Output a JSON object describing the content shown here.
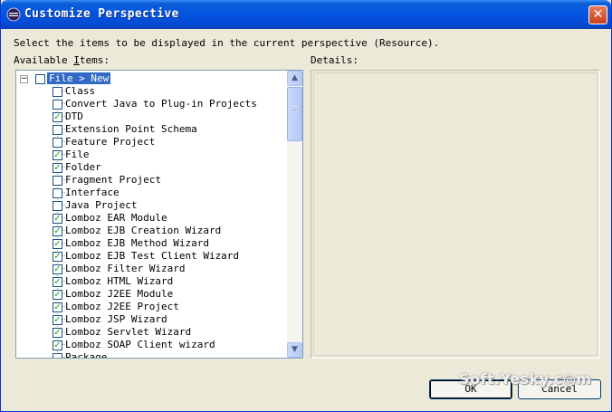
{
  "window": {
    "title": "Customize Perspective",
    "close_glyph": "✕",
    "title_icon": "eclipse-icon"
  },
  "instruction": "Select the items to be displayed in the current perspective (Resource).",
  "available_label": "Available Items:",
  "details_label": "Details:",
  "tree": {
    "root": {
      "label": "File > New",
      "checked": false,
      "expanded": true,
      "expander_glyph": "−"
    },
    "items": [
      {
        "label": "Class",
        "checked": false
      },
      {
        "label": "Convert Java to Plug-in Projects",
        "checked": false
      },
      {
        "label": "DTD",
        "checked": true
      },
      {
        "label": "Extension Point Schema",
        "checked": false
      },
      {
        "label": "Feature Project",
        "checked": false
      },
      {
        "label": "File",
        "checked": true
      },
      {
        "label": "Folder",
        "checked": true
      },
      {
        "label": "Fragment Project",
        "checked": false
      },
      {
        "label": "Interface",
        "checked": false
      },
      {
        "label": "Java Project",
        "checked": false
      },
      {
        "label": "Lomboz EAR Module",
        "checked": true
      },
      {
        "label": "Lomboz EJB Creation Wizard",
        "checked": true
      },
      {
        "label": "Lomboz EJB Method Wizard",
        "checked": true
      },
      {
        "label": "Lomboz EJB Test Client Wizard",
        "checked": true
      },
      {
        "label": "Lomboz Filter Wizard",
        "checked": true
      },
      {
        "label": "Lomboz HTML Wizard",
        "checked": true
      },
      {
        "label": "Lomboz J2EE Module",
        "checked": true
      },
      {
        "label": "Lomboz J2EE Project",
        "checked": true
      },
      {
        "label": "Lomboz JSP Wizard",
        "checked": true
      },
      {
        "label": "Lomboz Servlet Wizard",
        "checked": true
      },
      {
        "label": "Lomboz SOAP Client wizard",
        "checked": true
      },
      {
        "label": "Package",
        "checked": false
      }
    ]
  },
  "scrollbar": {
    "up_glyph": "▲",
    "down_glyph": "▼"
  },
  "buttons": {
    "ok": "OK",
    "cancel": "Cancel"
  },
  "watermark": "Soft.Yesky.c◎m",
  "check_glyph": "✓"
}
